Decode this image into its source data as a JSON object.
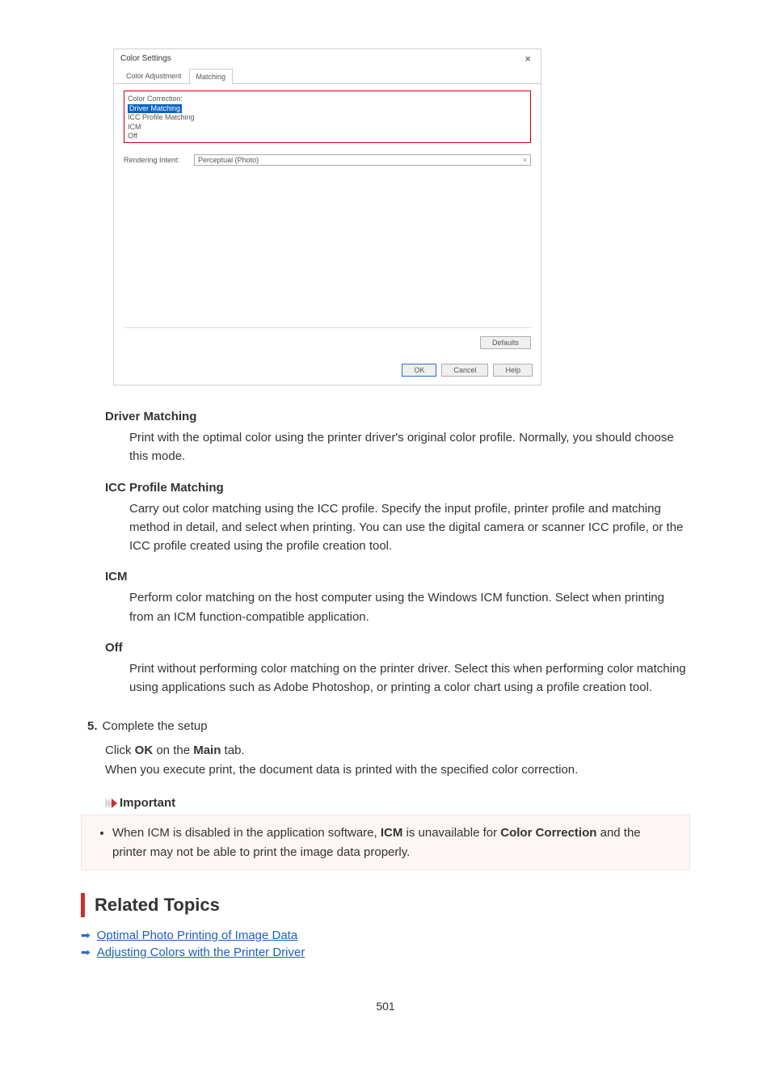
{
  "dialog": {
    "title": "Color Settings",
    "tabs": {
      "adjustment": "Color Adjustment",
      "matching": "Matching"
    },
    "color_correction_label": "Color Correction:",
    "cc_options": {
      "driver_matching": "Driver Matching",
      "icc_profile_matching": "ICC Profile Matching",
      "icm": "ICM",
      "off": "Off"
    },
    "rendering_intent_label": "Rendering Intent:",
    "rendering_intent_value": "Perceptual (Photo)",
    "defaults_btn": "Defaults",
    "ok_btn": "OK",
    "cancel_btn": "Cancel",
    "help_btn": "Help"
  },
  "items": {
    "driver_matching": {
      "title": "Driver Matching",
      "desc": "Print with the optimal color using the printer driver's original color profile. Normally, you should choose this mode."
    },
    "icc_profile_matching": {
      "title": "ICC Profile Matching",
      "desc": "Carry out color matching using the ICC profile. Specify the input profile, printer profile and matching method in detail, and select when printing. You can use the digital camera or scanner ICC profile, or the ICC profile created using the profile creation tool."
    },
    "icm": {
      "title": "ICM",
      "desc": "Perform color matching on the host computer using the Windows ICM function. Select when printing from an ICM function-compatible application."
    },
    "off": {
      "title": "Off",
      "desc": "Print without performing color matching on the printer driver. Select this when performing color matching using applications such as Adobe Photoshop, or printing a color chart using a profile creation tool."
    }
  },
  "step5": {
    "num": "5.",
    "title": "Complete the setup",
    "line1_pre": "Click ",
    "line1_b1": "OK",
    "line1_mid": " on the ",
    "line1_b2": "Main",
    "line1_post": " tab.",
    "line2": "When you execute print, the document data is printed with the specified color correction."
  },
  "important": {
    "heading": "Important",
    "bullet_pre": "When ICM is disabled in the application software, ",
    "bullet_b1": "ICM",
    "bullet_mid": " is unavailable for ",
    "bullet_b2": "Color Correction",
    "bullet_post": " and the printer may not be able to print the image data properly."
  },
  "related": {
    "heading": "Related Topics",
    "links": {
      "l1": "Optimal Photo Printing of Image Data",
      "l2": "Adjusting Colors with the Printer Driver"
    }
  },
  "page_number": "501"
}
